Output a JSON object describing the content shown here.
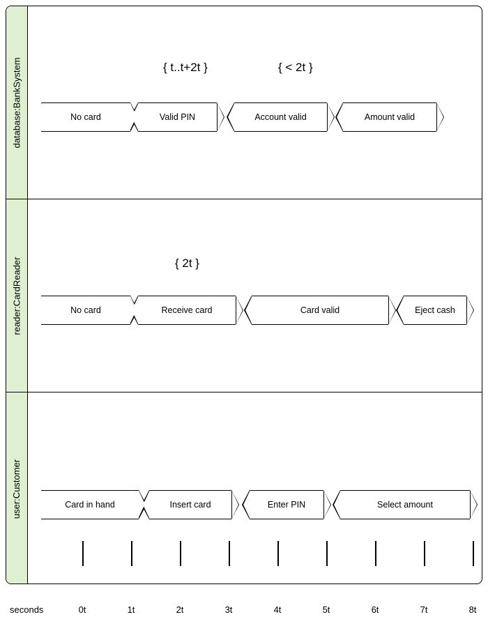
{
  "lanes": {
    "bank": {
      "title": "database:BankSystem"
    },
    "reader": {
      "title": "reader:CardReader"
    },
    "user": {
      "title": "user:Customer"
    }
  },
  "constraints": {
    "bank1": "{ t..t+2t }",
    "bank2": "{ < 2t }",
    "reader1": "{ 2t }"
  },
  "states": {
    "bank": {
      "s0": "No card",
      "s1": "Valid PIN",
      "s2": "Account valid",
      "s3": "Amount valid"
    },
    "reader": {
      "s0": "No card",
      "s1": "Receive card",
      "s2": "Card valid",
      "s3": "Eject cash"
    },
    "user": {
      "s0": "Card in hand",
      "s1": "Insert card",
      "s2": "Enter PIN",
      "s3": "Select amount"
    }
  },
  "axis": {
    "label": "seconds",
    "ticks": [
      "0t",
      "1t",
      "2t",
      "3t",
      "4t",
      "5t",
      "6t",
      "7t",
      "8t"
    ]
  }
}
